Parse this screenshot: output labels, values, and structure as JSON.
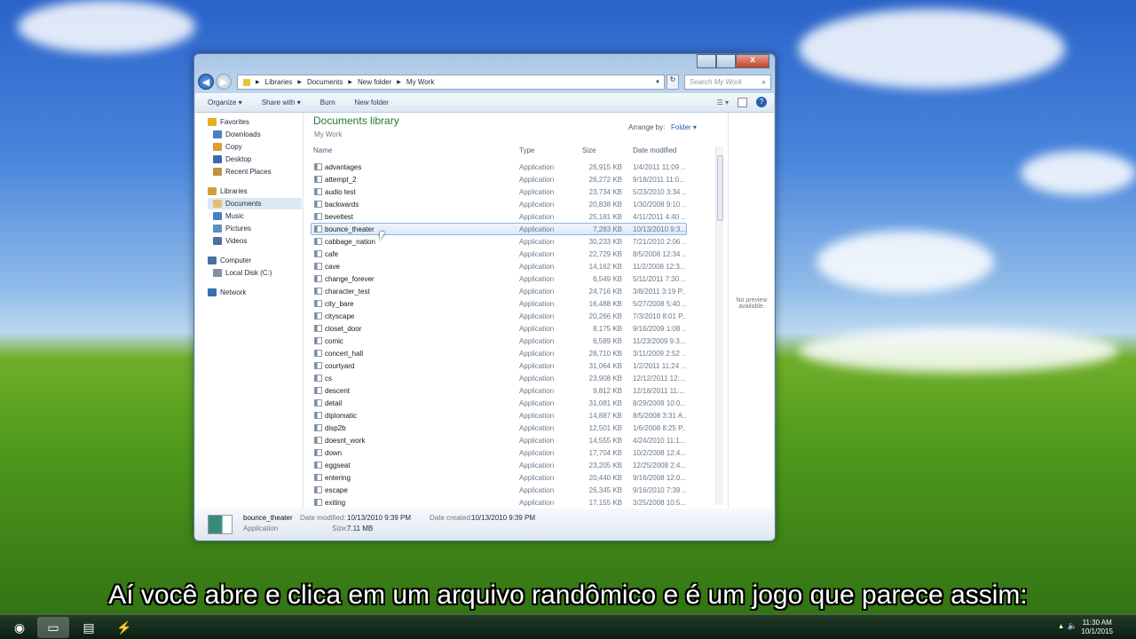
{
  "window": {
    "caption": {
      "minimize": "",
      "maximize": "",
      "close": "x"
    },
    "breadcrumb": [
      "Libraries",
      "Documents",
      "New folder",
      "My Work"
    ],
    "search_placeholder": "Search My Work",
    "toolbar": {
      "organize": "Organize ▾",
      "share": "Share with ▾",
      "burn": "Burn",
      "new_folder": "New folder"
    },
    "sidebar": [
      {
        "label": "Favorites",
        "group": true,
        "color": "#e8b020"
      },
      {
        "label": "Downloads",
        "color": "#4a7fc0"
      },
      {
        "label": "Copy",
        "color": "#d8a030"
      },
      {
        "label": "Desktop",
        "color": "#3a6ab0"
      },
      {
        "label": "Recent Places",
        "color": "#c09040"
      },
      {
        "label": "Libraries",
        "group": true,
        "color": "#d0a040"
      },
      {
        "label": "Documents",
        "color": "#e0c070",
        "selected": true
      },
      {
        "label": "Music",
        "color": "#4a80c0"
      },
      {
        "label": "Pictures",
        "color": "#5a90c0"
      },
      {
        "label": "Videos",
        "color": "#5070a0"
      },
      {
        "label": "Computer",
        "group": true,
        "color": "#4a70a0"
      },
      {
        "label": "Local Disk (C:)",
        "color": "#8090a0"
      },
      {
        "label": "Network",
        "group": true,
        "color": "#3a70b0"
      }
    ],
    "library": {
      "title": "Documents library",
      "subtitle": "My Work",
      "arrange_label": "Arrange by:",
      "arrange_value": "Folder ▾"
    },
    "columns": {
      "name": "Name",
      "type": "Type",
      "size": "Size",
      "date": "Date modified"
    },
    "files": [
      [
        "advantages",
        "Application",
        "26,915 KB",
        "1/4/2011 11:09 ..."
      ],
      [
        "attempt_2",
        "Application",
        "26,272 KB",
        "9/18/2011 11:0..."
      ],
      [
        "audio test",
        "Application",
        "23,734 KB",
        "5/23/2010 3:34 ..."
      ],
      [
        "backwards",
        "Application",
        "20,838 KB",
        "1/30/2008 9:10 ..."
      ],
      [
        "beveltest",
        "Application",
        "25,181 KB",
        "4/11/2011 4:40 ..."
      ],
      [
        "bounce_theater",
        "Application",
        "7,283 KB",
        "10/13/2010 9:3..."
      ],
      [
        "cabbage_nation",
        "Application",
        "30,233 KB",
        "7/21/2010 2:06 ..."
      ],
      [
        "cafe",
        "Application",
        "22,729 KB",
        "8/5/2008 12:34 ..."
      ],
      [
        "cave",
        "Application",
        "14,162 KB",
        "11/2/2008 12:3..."
      ],
      [
        "change_forever",
        "Application",
        "6,549 KB",
        "5/11/2011 7:30 ..."
      ],
      [
        "character_test",
        "Application",
        "24,716 KB",
        "3/8/2011 3:19 P..."
      ],
      [
        "city_bare",
        "Application",
        "16,488 KB",
        "5/27/2008 5:40 ..."
      ],
      [
        "cityscape",
        "Application",
        "20,266 KB",
        "7/3/2010 8:01 P..."
      ],
      [
        "closet_door",
        "Application",
        "8,175 KB",
        "9/16/2009 1:08 ..."
      ],
      [
        "comic",
        "Application",
        "6,589 KB",
        "11/23/2009 9:3..."
      ],
      [
        "concert_hall",
        "Application",
        "28,710 KB",
        "3/11/2009 2:52 ..."
      ],
      [
        "courtyard",
        "Application",
        "31,064 KB",
        "1/2/2011 11:24 ..."
      ],
      [
        "cs",
        "Application",
        "23,908 KB",
        "12/12/2011 12:..."
      ],
      [
        "descent",
        "Application",
        "9,812 KB",
        "12/18/2011 11:..."
      ],
      [
        "detail",
        "Application",
        "31,081 KB",
        "8/29/2009 10:0..."
      ],
      [
        "diplomatic",
        "Application",
        "14,887 KB",
        "8/5/2008 3:31 A..."
      ],
      [
        "disp2b",
        "Application",
        "12,501 KB",
        "1/6/2008 8:25 P..."
      ],
      [
        "doesnt_work",
        "Application",
        "14,555 KB",
        "4/24/2010 11:1..."
      ],
      [
        "down",
        "Application",
        "17,704 KB",
        "10/2/2008 12:4..."
      ],
      [
        "eggseat",
        "Application",
        "23,205 KB",
        "12/25/2008 2:4..."
      ],
      [
        "entering",
        "Application",
        "20,440 KB",
        "9/16/2008 12:0..."
      ],
      [
        "escape",
        "Application",
        "26,345 KB",
        "9/16/2010 7:39 ..."
      ],
      [
        "exiting",
        "Application",
        "17,155 KB",
        "3/25/2008 10:5..."
      ]
    ],
    "selected_index": 5,
    "preview": "No preview available.",
    "details": {
      "name": "bounce_theater",
      "type": "Application",
      "modified_label": "Date modified:",
      "modified": "10/13/2010 9:39 PM",
      "created_label": "Date created:",
      "created": "10/13/2010 9:39 PM",
      "size_label": "Size:",
      "size": "7.11 MB"
    }
  },
  "subtitle": "Aí você abre e clica em um arquivo randômico e é um jogo que parece assim:",
  "taskbar": {
    "time": "11:30 AM",
    "date": "10/1/2015"
  }
}
